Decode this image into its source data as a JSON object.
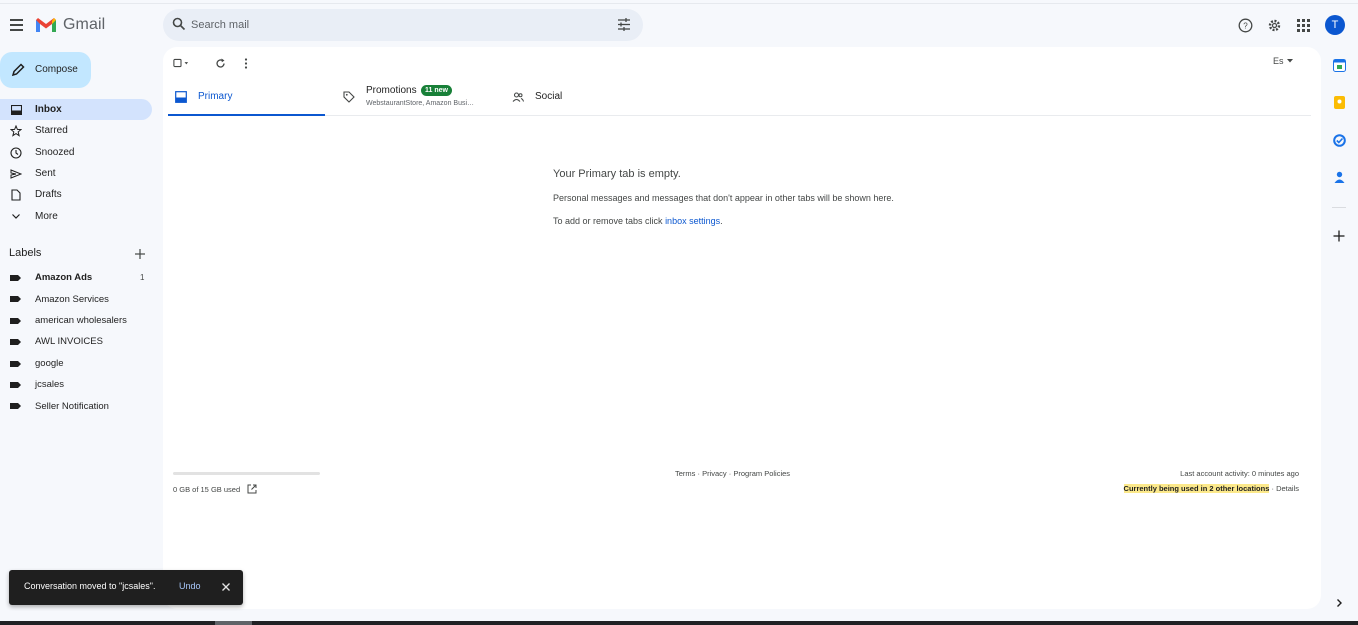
{
  "app": {
    "name": "Gmail"
  },
  "search": {
    "placeholder": "Search mail"
  },
  "header": {
    "avatar_letter": "T"
  },
  "sidebar": {
    "compose_label": "Compose",
    "items": [
      {
        "label": "Inbox",
        "icon": "inbox-icon",
        "active": true
      },
      {
        "label": "Starred",
        "icon": "star-icon"
      },
      {
        "label": "Snoozed",
        "icon": "clock-icon"
      },
      {
        "label": "Sent",
        "icon": "send-icon"
      },
      {
        "label": "Drafts",
        "icon": "draft-icon"
      },
      {
        "label": "More",
        "icon": "chevron-down-icon"
      }
    ],
    "labels_heading": "Labels",
    "labels": [
      {
        "label": "Amazon Ads",
        "count": "1"
      },
      {
        "label": "Amazon Services"
      },
      {
        "label": "american wholesalers"
      },
      {
        "label": "AWL INVOICES"
      },
      {
        "label": "google"
      },
      {
        "label": "jcsales"
      },
      {
        "label": "Seller Notification"
      }
    ]
  },
  "toolbar": {
    "input_tools": "Es"
  },
  "tabs": {
    "primary": "Primary",
    "promotions": "Promotions",
    "promotions_badge": "11 new",
    "promotions_sub": "WebstaurantStore, Amazon Busi…",
    "social": "Social"
  },
  "empty_state": {
    "title": "Your Primary tab is empty.",
    "message": "Personal messages and messages that don't appear in other tabs will be shown here.",
    "settings_prefix": "To add or remove tabs click ",
    "settings_link": "inbox settings",
    "settings_suffix": "."
  },
  "footer": {
    "storage": "0 GB of 15 GB used",
    "storage_fraction": 0.0,
    "terms": "Terms",
    "privacy": "Privacy",
    "policies": "Program Policies",
    "last_activity": "Last account activity: 0 minutes ago",
    "locations": "Currently being used in 2 other locations",
    "details": "Details"
  },
  "snackbar": {
    "message": "Conversation moved to \"jcsales\".",
    "undo": "Undo"
  },
  "colors": {
    "accent": "#0b57d0",
    "compose_bg": "#c2e7ff",
    "active_nav": "#d3e3fd",
    "badge_green": "#188038"
  }
}
